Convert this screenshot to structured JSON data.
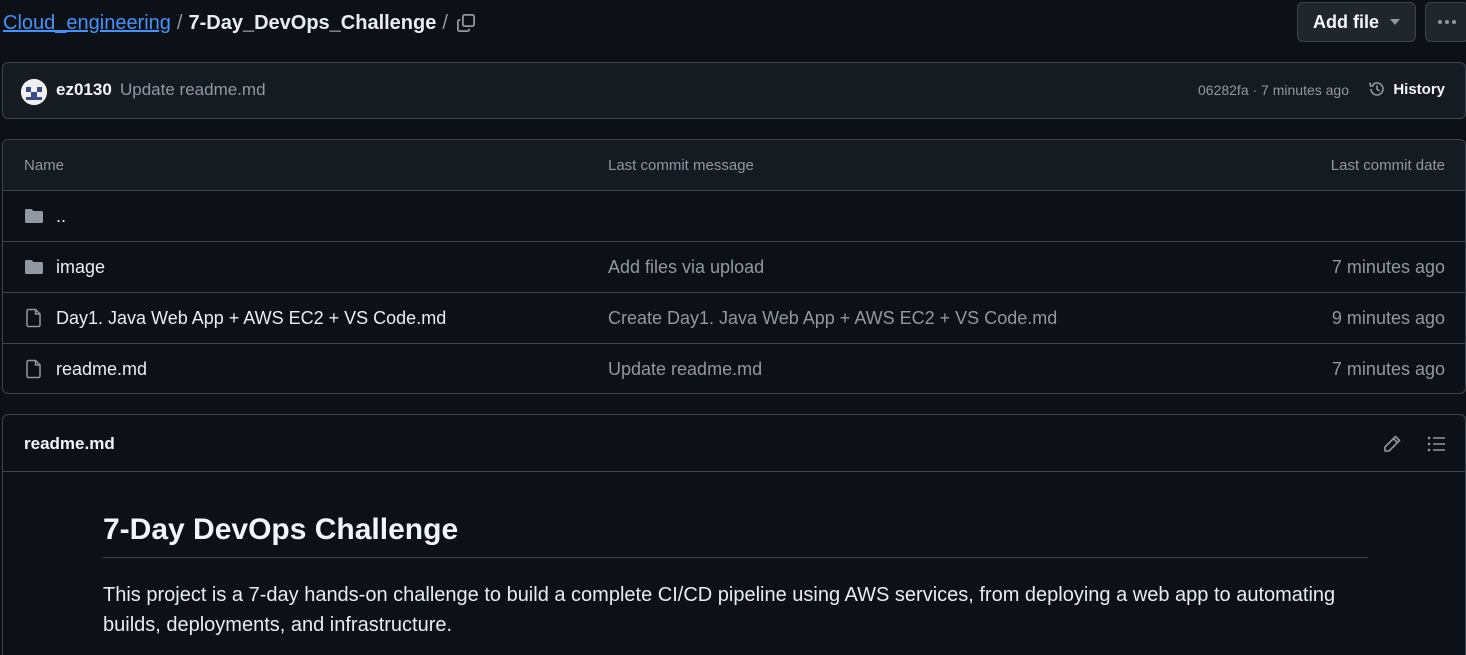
{
  "breadcrumb": {
    "parent": "Cloud_engineering",
    "separator": "/",
    "current": "7-Day_DevOps_Challenge",
    "trailing_separator": "/"
  },
  "header": {
    "add_file_label": "Add file",
    "more_icon": "kebab-horizontal-icon",
    "copy_icon": "copy-icon"
  },
  "latest_commit": {
    "author": "ez0130",
    "message": "Update readme.md",
    "meta": "06282fa · 7 minutes ago",
    "history_label": "History"
  },
  "table": {
    "columns": {
      "name": "Name",
      "message": "Last commit message",
      "date": "Last commit date"
    },
    "rows": [
      {
        "type": "folder",
        "name": "..",
        "message": "",
        "date": ""
      },
      {
        "type": "folder",
        "name": "image",
        "message": "Add files via upload",
        "date": "7 minutes ago"
      },
      {
        "type": "file",
        "name": "Day1. Java Web App + AWS EC2 + VS Code.md",
        "message": "Create Day1. Java Web App + AWS EC2 + VS Code.md",
        "date": "9 minutes ago"
      },
      {
        "type": "file",
        "name": "readme.md",
        "message": "Update readme.md",
        "date": "7 minutes ago"
      }
    ]
  },
  "readme": {
    "filename": "readme.md",
    "heading": "7-Day DevOps Challenge",
    "paragraph": "This project is a 7-day hands-on challenge to build a complete CI/CD pipeline using AWS services, from deploying a web app to automating builds, deployments, and infrastructure."
  },
  "colors": {
    "background": "#0d1117",
    "link": "#4493f8",
    "border": "#3d444d",
    "muted": "#9198a1"
  }
}
